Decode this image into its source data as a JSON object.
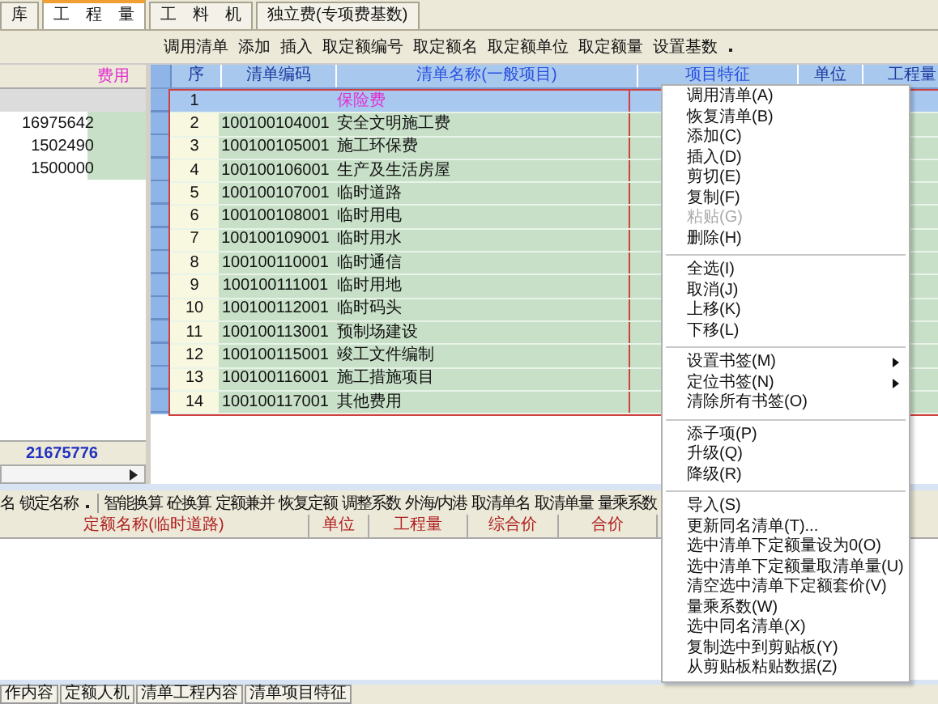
{
  "tabs": [
    {
      "label": "库",
      "selected": false
    },
    {
      "label": "工　程　量",
      "selected": true
    },
    {
      "label": "工　料　机",
      "selected": false
    },
    {
      "label": "独立费(专项费基数)",
      "selected": false
    }
  ],
  "toolbar": [
    "调用清单",
    "添加",
    "插入",
    "取定额编号",
    "取定额名",
    "取定额单位",
    "取定额量",
    "设置基数"
  ],
  "left_panel": {
    "header": "费用",
    "rows": [
      {
        "selected": true
      },
      {
        "value": "16975642",
        "selected": false
      },
      {
        "value": "1502490",
        "selected": false
      },
      {
        "value": "1500000",
        "selected": false
      }
    ],
    "total": "21675776"
  },
  "grid": {
    "columns": [
      "序",
      "清单编码",
      "清单名称(一般项目)",
      "项目特征",
      "单位",
      "工程量"
    ],
    "rows": [
      {
        "no": "1",
        "name": "保险费",
        "selected": true
      },
      {
        "no": "2",
        "code": "100100104001",
        "name": "安全文明施工费",
        "selected": false
      },
      {
        "no": "3",
        "code": "100100105001",
        "name": "施工环保费",
        "selected": false
      },
      {
        "no": "4",
        "code": "100100106001",
        "name": "生产及生活房屋",
        "selected": false
      },
      {
        "no": "5",
        "code": "100100107001",
        "name": "临时道路",
        "selected": false
      },
      {
        "no": "6",
        "code": "100100108001",
        "name": "临时用电",
        "selected": false
      },
      {
        "no": "7",
        "code": "100100109001",
        "name": "临时用水",
        "selected": false
      },
      {
        "no": "8",
        "code": "100100110001",
        "name": "临时通信",
        "selected": false
      },
      {
        "no": "9",
        "code": "100100111001",
        "name": "临时用地",
        "selected": false
      },
      {
        "no": "10",
        "code": "100100112001",
        "name": "临时码头",
        "selected": false
      },
      {
        "no": "11",
        "code": "100100113001",
        "name": "预制场建设",
        "selected": false
      },
      {
        "no": "12",
        "code": "100100115001",
        "name": "竣工文件编制",
        "selected": false
      },
      {
        "no": "13",
        "code": "100100116001",
        "name": "施工措施项目",
        "selected": false
      },
      {
        "no": "14",
        "code": "100100117001",
        "name": "其他费用",
        "selected": false
      }
    ]
  },
  "context_menu": [
    {
      "kind": "item",
      "label": "调用清单(A)",
      "disabled": false
    },
    {
      "kind": "item",
      "label": "恢复清单(B)",
      "disabled": false
    },
    {
      "kind": "item",
      "label": "添加(C)",
      "disabled": false
    },
    {
      "kind": "item",
      "label": "插入(D)",
      "disabled": false
    },
    {
      "kind": "item",
      "label": "剪切(E)",
      "disabled": false
    },
    {
      "kind": "item",
      "label": "复制(F)",
      "disabled": false
    },
    {
      "kind": "item",
      "label": "粘贴(G)",
      "disabled": true
    },
    {
      "kind": "item",
      "label": "删除(H)",
      "disabled": false
    },
    {
      "kind": "separator"
    },
    {
      "kind": "item",
      "label": "全选(I)",
      "disabled": false
    },
    {
      "kind": "item",
      "label": "取消(J)",
      "disabled": false
    },
    {
      "kind": "item",
      "label": "上移(K)",
      "disabled": false
    },
    {
      "kind": "item",
      "label": "下移(L)",
      "disabled": false
    },
    {
      "kind": "separator"
    },
    {
      "kind": "submenu",
      "label": "设置书签(M)",
      "disabled": false
    },
    {
      "kind": "submenu",
      "label": "定位书签(N)",
      "disabled": false
    },
    {
      "kind": "item",
      "label": "清除所有书签(O)",
      "disabled": false
    },
    {
      "kind": "separator"
    },
    {
      "kind": "item",
      "label": "添子项(P)",
      "disabled": false
    },
    {
      "kind": "item",
      "label": "升级(Q)",
      "disabled": false
    },
    {
      "kind": "item",
      "label": "降级(R)",
      "disabled": false
    },
    {
      "kind": "separator"
    },
    {
      "kind": "item",
      "label": "导入(S)",
      "disabled": false
    },
    {
      "kind": "item",
      "label": "更新同名清单(T)...",
      "disabled": false
    },
    {
      "kind": "item",
      "label": "选中清单下定额量设为0(O)",
      "disabled": false
    },
    {
      "kind": "item",
      "label": "选中清单下定额量取清单量(U)",
      "disabled": false
    },
    {
      "kind": "item",
      "label": "清空选中清单下定额套价(V)",
      "disabled": false
    },
    {
      "kind": "item",
      "label": "量乘系数(W)",
      "disabled": false
    },
    {
      "kind": "item",
      "label": "选中同名清单(X)",
      "disabled": false
    },
    {
      "kind": "item",
      "label": "复制选中到剪贴板(Y)",
      "disabled": false
    },
    {
      "kind": "item",
      "label": "从剪贴板粘贴数据(Z)",
      "disabled": false
    }
  ],
  "bottom_toolbar": {
    "left": [
      "名",
      "锁定名称"
    ],
    "right": [
      "智能换算",
      "砼换算",
      "定额兼并",
      "恢复定额",
      "调整系数",
      "外海/内港",
      "取清单名",
      "取清单量",
      "量乘系数"
    ]
  },
  "bottom_grid": {
    "columns": [
      "定额名称(临时道路)",
      "单位",
      "工程量",
      "综合价",
      "合价"
    ]
  },
  "bottom_tabs": [
    "作内容",
    "定额人机",
    "清单工程内容",
    "清单项目特征"
  ]
}
